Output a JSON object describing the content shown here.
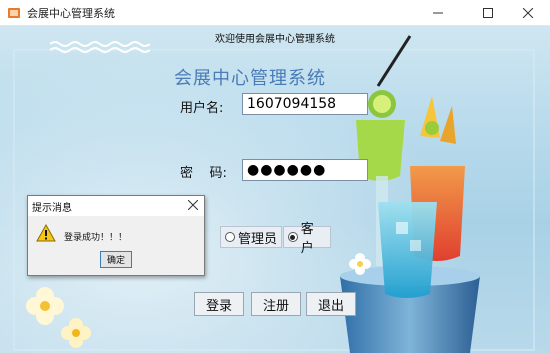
{
  "window": {
    "title": "会展中心管理系统",
    "controls": {
      "minimize_icon": "minimize-icon",
      "maximize_icon": "maximize-icon",
      "close_icon": "close-icon"
    }
  },
  "header": {
    "welcome": "欢迎使用会展中心管理系统",
    "system_title": "会展中心管理系统"
  },
  "form": {
    "username_label": "用户名:",
    "username_value": "1607094158",
    "password_label": "密    码:",
    "password_value": "●●●●●●",
    "role_options": [
      {
        "label": "管理员",
        "selected": false
      },
      {
        "label": "客户",
        "selected": true
      }
    ]
  },
  "buttons": {
    "login": "登录",
    "register": "注册",
    "exit": "退出"
  },
  "dialog": {
    "title": "提示消息",
    "message": "登录成功！！！",
    "ok": "确定",
    "icon": "warning-icon"
  },
  "colors": {
    "title_blue": "#4a7cb8",
    "background": "#b9dbec",
    "dialog_focus": "#3c7fb1"
  }
}
